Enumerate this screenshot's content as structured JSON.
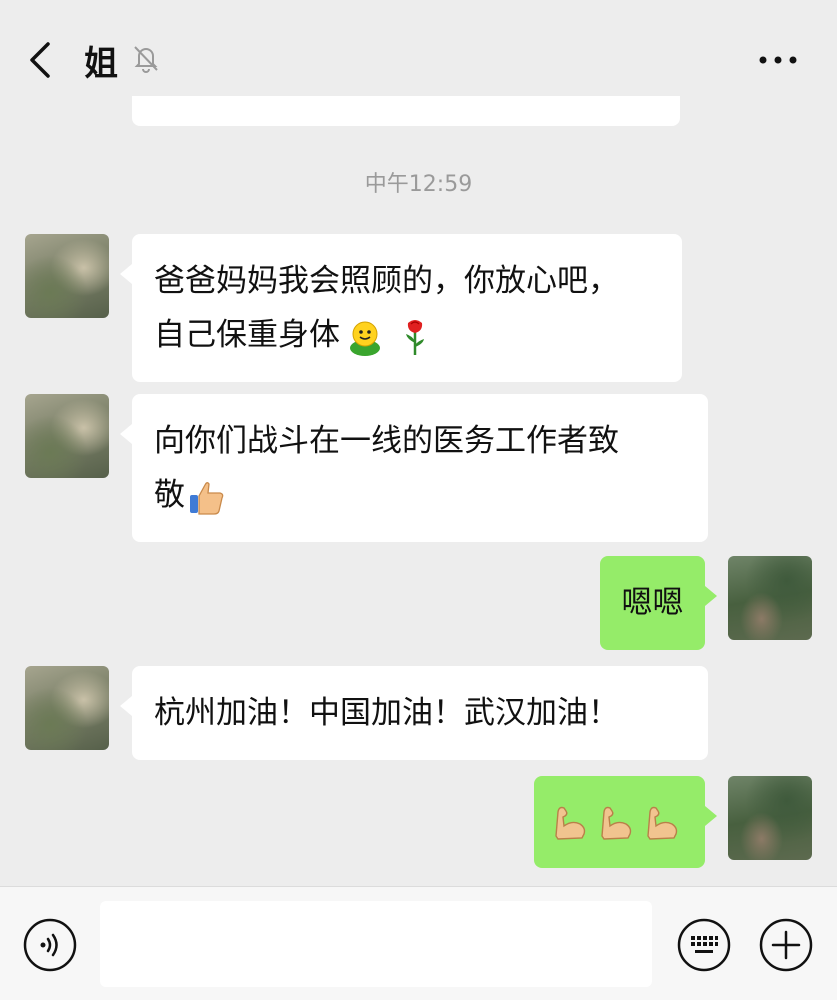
{
  "header": {
    "title": "姐",
    "back_icon": "chevron-left-icon",
    "mute_icon": "bell-off-icon",
    "more_icon": "more-dots-icon"
  },
  "timestamp": "中午12:59",
  "messages": [
    {
      "sender": "sister",
      "lines": [
        "爸爸妈妈我会照顾的，你放心吧，",
        "自己保重身体"
      ],
      "emojis": [
        "smiling-blob-emoji",
        "rose-emoji"
      ]
    },
    {
      "sender": "sister",
      "lines": [
        "向你们战斗在一线的医务工作者致",
        "敬"
      ],
      "emojis": [
        "thumbs-up-emoji"
      ]
    },
    {
      "sender": "me",
      "lines": [
        "嗯嗯"
      ],
      "emojis": []
    },
    {
      "sender": "sister",
      "lines": [
        "杭州加油！中国加油！武汉加油！"
      ],
      "emojis": []
    },
    {
      "sender": "me",
      "lines": [],
      "emojis": [
        "flexed-biceps-emoji",
        "flexed-biceps-emoji",
        "flexed-biceps-emoji"
      ]
    }
  ],
  "input": {
    "value": "",
    "voice_icon": "voice-icon",
    "keyboard_icon": "keyboard-icon",
    "plus_icon": "plus-icon"
  },
  "colors": {
    "background": "#ededed",
    "bubble_in": "#ffffff",
    "bubble_out": "#95ec69",
    "timestamp": "#9a9a9a"
  }
}
